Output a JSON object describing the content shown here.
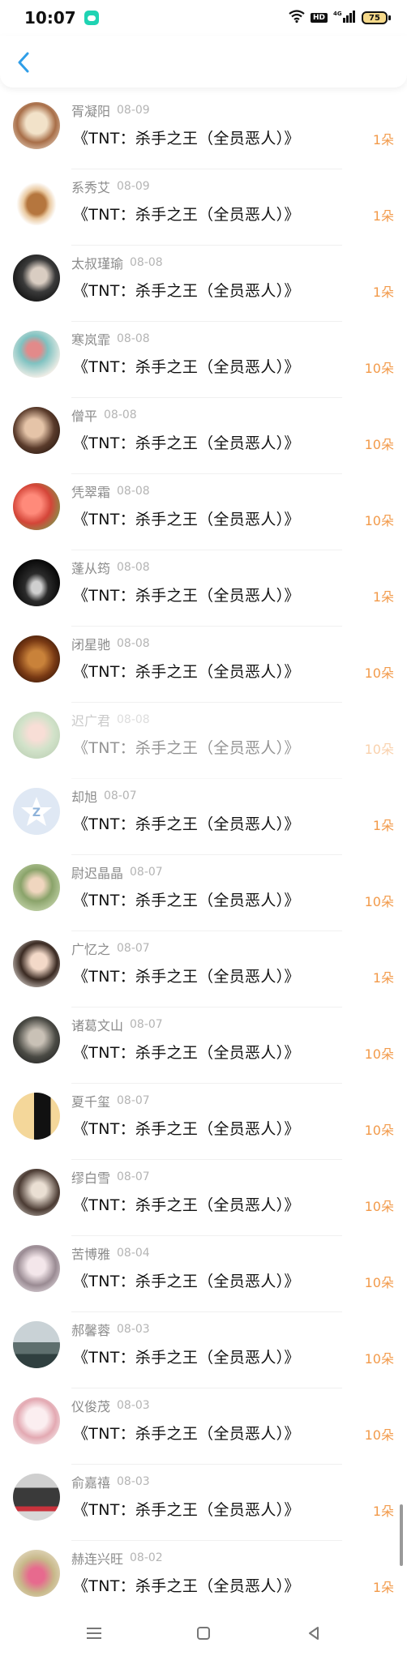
{
  "status_bar": {
    "time": "10:07",
    "hd": "HD",
    "network": "4G",
    "battery": "75"
  },
  "header": {
    "back_icon": "chevron-left-icon"
  },
  "colors": {
    "accent": "#f29a4a",
    "back": "#2f9ee8"
  },
  "records": [
    {
      "name": "胥凝阳",
      "date": "08-09",
      "title": "《TNT：杀手之王（全员恶人）》",
      "amount": "1朵"
    },
    {
      "name": "系秀艾",
      "date": "08-09",
      "title": "《TNT：杀手之王（全员恶人）》",
      "amount": "1朵"
    },
    {
      "name": "太叔瑾瑜",
      "date": "08-08",
      "title": "《TNT：杀手之王（全员恶人）》",
      "amount": "1朵"
    },
    {
      "name": "寒岚霏",
      "date": "08-08",
      "title": "《TNT：杀手之王（全员恶人）》",
      "amount": "10朵"
    },
    {
      "name": "僧平",
      "date": "08-08",
      "title": "《TNT：杀手之王（全员恶人）》",
      "amount": "10朵"
    },
    {
      "name": "凭翠霜",
      "date": "08-08",
      "title": "《TNT：杀手之王（全员恶人）》",
      "amount": "10朵"
    },
    {
      "name": "蓬从筠",
      "date": "08-08",
      "title": "《TNT：杀手之王（全员恶人）》",
      "amount": "1朵"
    },
    {
      "name": "闭星驰",
      "date": "08-08",
      "title": "《TNT：杀手之王（全员恶人）》",
      "amount": "10朵"
    },
    {
      "name": "迟广君",
      "date": "08-08",
      "title": "《TNT：杀手之王（全员恶人）》",
      "amount": "10朵"
    },
    {
      "name": "却旭",
      "date": "08-07",
      "title": "《TNT：杀手之王（全员恶人）》",
      "amount": "1朵"
    },
    {
      "name": "尉迟晶晶",
      "date": "08-07",
      "title": "《TNT：杀手之王（全员恶人）》",
      "amount": "10朵"
    },
    {
      "name": "广忆之",
      "date": "08-07",
      "title": "《TNT：杀手之王（全员恶人）》",
      "amount": "1朵"
    },
    {
      "name": "诸葛文山",
      "date": "08-07",
      "title": "《TNT：杀手之王（全员恶人）》",
      "amount": "10朵"
    },
    {
      "name": "夏千玺",
      "date": "08-07",
      "title": "《TNT：杀手之王（全员恶人）》",
      "amount": "10朵"
    },
    {
      "name": "缪白雪",
      "date": "08-07",
      "title": "《TNT：杀手之王（全员恶人）》",
      "amount": "10朵"
    },
    {
      "name": "苦博雅",
      "date": "08-04",
      "title": "《TNT：杀手之王（全员恶人）》",
      "amount": "10朵"
    },
    {
      "name": "郝馨蓉",
      "date": "08-03",
      "title": "《TNT：杀手之王（全员恶人）》",
      "amount": "10朵"
    },
    {
      "name": "仪俊茂",
      "date": "08-03",
      "title": "《TNT：杀手之王（全员恶人）》",
      "amount": "10朵"
    },
    {
      "name": "俞嘉禧",
      "date": "08-03",
      "title": "《TNT：杀手之王（全员恶人）》",
      "amount": "1朵"
    },
    {
      "name": "赫连兴旺",
      "date": "08-02",
      "title": "《TNT：杀手之王（全员恶人）》",
      "amount": "1朵"
    }
  ],
  "nav_bar": {
    "menu_icon": "menu-icon",
    "home_icon": "home-square-icon",
    "back_icon": "back-triangle-icon"
  }
}
